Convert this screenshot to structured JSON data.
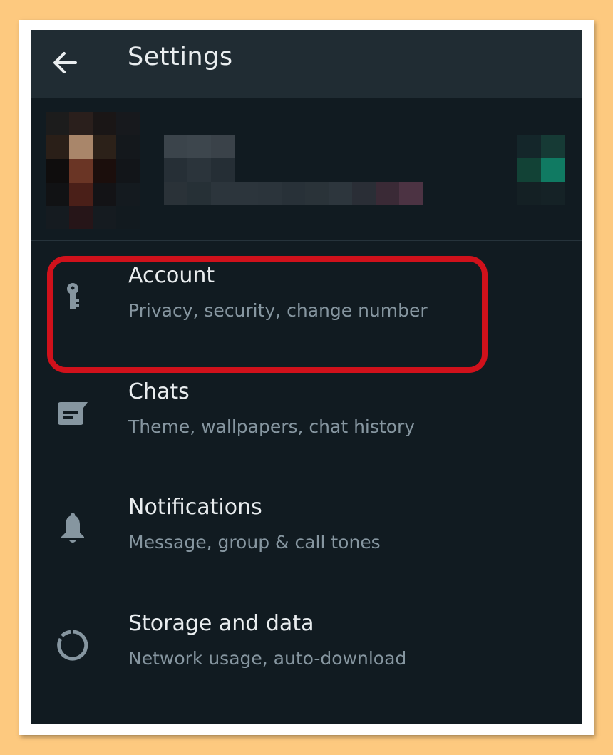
{
  "app_bar": {
    "title": "Settings",
    "back_icon": "arrow-left-icon"
  },
  "profile": {
    "avatar_icon": "avatar-pixelated",
    "name_redacted": true,
    "qr_icon": "qr-code-icon"
  },
  "settings_items": [
    {
      "label": "Account",
      "subtitle": "Privacy, security, change number",
      "icon": "key-icon",
      "highlighted": true
    },
    {
      "label": "Chats",
      "subtitle": "Theme, wallpapers, chat history",
      "icon": "chat-icon"
    },
    {
      "label": "Notifications",
      "subtitle": "Message, group & call tones",
      "icon": "bell-icon"
    },
    {
      "label": "Storage and data",
      "subtitle": "Network usage, auto-download",
      "icon": "storage-circle-icon"
    }
  ],
  "colors": {
    "background_outer": "#fdc97f",
    "app_bar": "#202c33",
    "screen": "#111b21",
    "primary_text": "#e9edef",
    "secondary_text": "#8696a0",
    "highlight_border": "#d0111b",
    "accent": "#00a884"
  }
}
